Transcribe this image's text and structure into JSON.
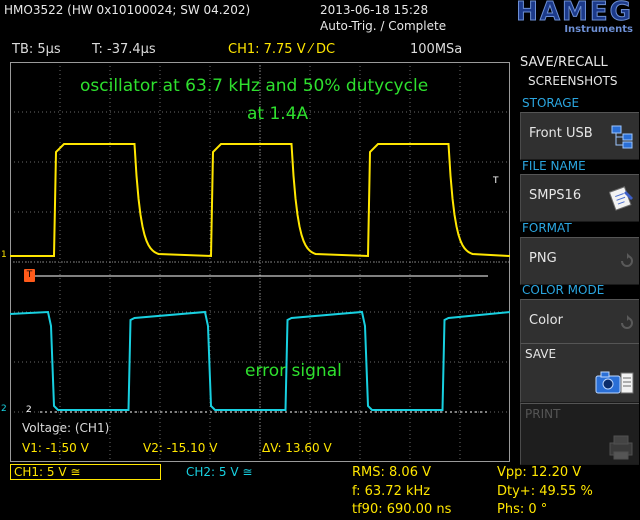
{
  "header": {
    "model": "HMO3522 (HW 0x10100024; SW 04.202)",
    "datetime": "2013-06-18 15:28",
    "trigger_status": "Auto-Trig. / Complete",
    "brand": "HAMEG",
    "brand_sub": "Instruments"
  },
  "settings": {
    "timebase": "TB: 5µs",
    "trigger_time": "T: -37.4µs",
    "ch1_trigger": "CH1: 7.75 V ⁄ DC",
    "sample_rate": "100MSa"
  },
  "annotations": {
    "title_line1": "oscillator at 63.7 kHz and 50% dutycycle",
    "title_line2": "at 1.4A",
    "error_label": "error signal"
  },
  "markers": {
    "ch1": "1",
    "ch2": "2",
    "trig": "T",
    "trig_right": "T"
  },
  "cursor_readout": {
    "title": "Voltage: (CH1)",
    "v1": "V1: -1.50 V",
    "v2": "V2: -15.10 V",
    "dv": "ΔV: 13.60 V"
  },
  "side_menu": {
    "title": "SAVE/RECALL",
    "subtitle": "SCREENSHOTS",
    "storage_label": "STORAGE",
    "storage_value": "Front USB",
    "filename_label": "FILE NAME",
    "filename_value": "SMPS16",
    "format_label": "FORMAT",
    "format_value": "PNG",
    "colormode_label": "COLOR MODE",
    "colormode_value": "Color",
    "save_label": "SAVE",
    "print_label": "PRINT"
  },
  "status_bar": {
    "ch1": "CH1: 5 V ≅",
    "ch2": "CH2: 5 V ≅",
    "rms": "RMS: 8.06 V",
    "freq": "f: 63.72 kHz",
    "tf90": "tf90: 690.00 ns",
    "vpp": "Vpp: 12.20 V",
    "duty": "Dty+: 49.55 %",
    "phase": "Phs: 0 °"
  },
  "colors": {
    "ch1": "#ffe600",
    "ch2": "#18d0e0",
    "annotation": "#2ee02e",
    "menu_accent": "#2ba6e0"
  }
}
